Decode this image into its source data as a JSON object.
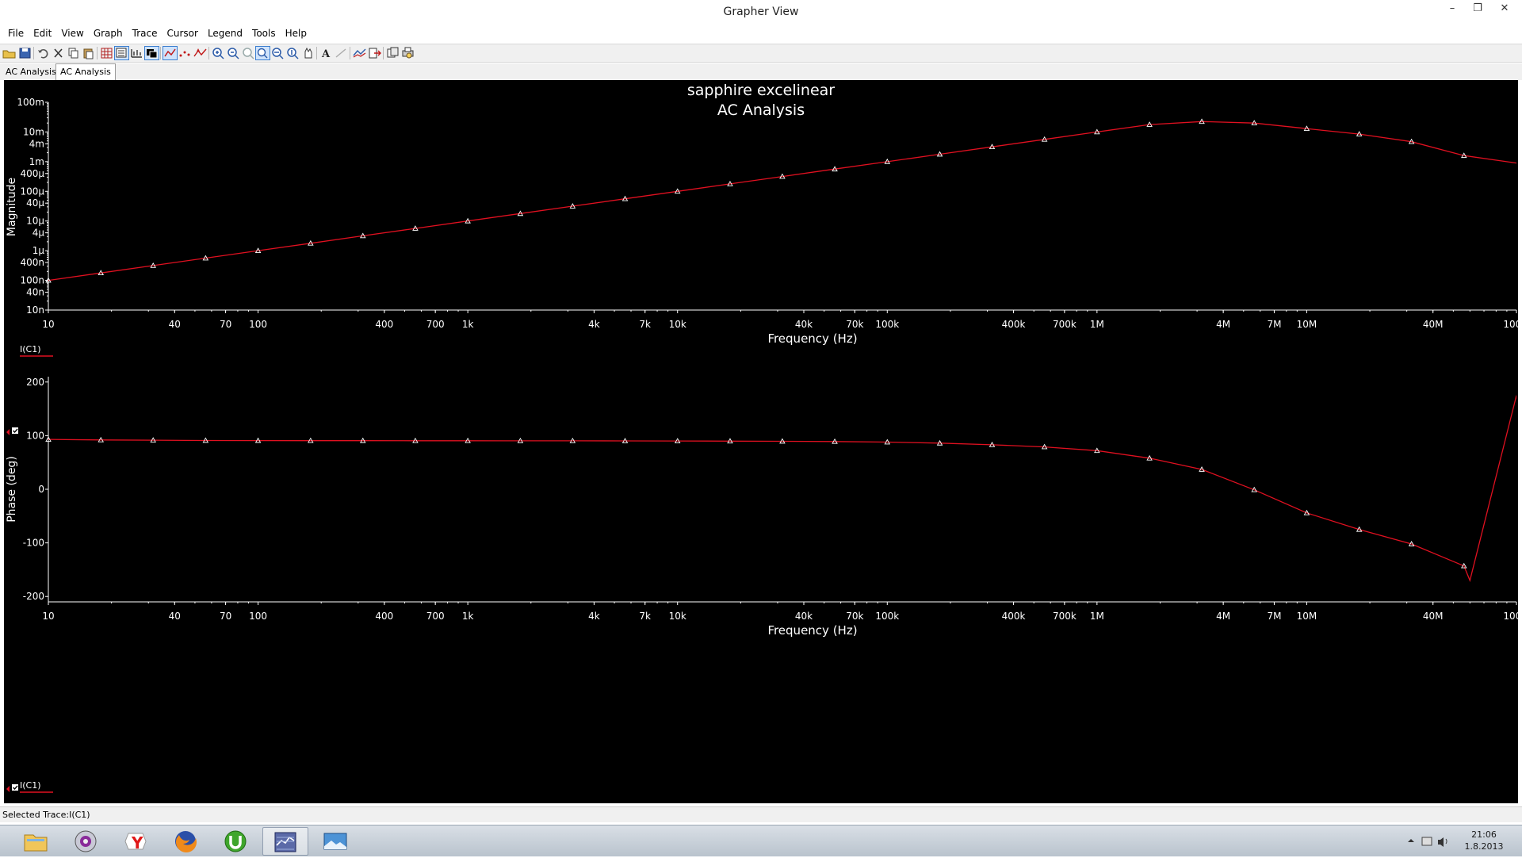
{
  "window": {
    "title": "Grapher View",
    "min": "–",
    "max": "❐",
    "close": "✕"
  },
  "menu": [
    "File",
    "Edit",
    "View",
    "Graph",
    "Trace",
    "Cursor",
    "Legend",
    "Tools",
    "Help"
  ],
  "tabs": [
    "AC Analysis",
    "AC Analysis"
  ],
  "graph": {
    "title": "sapphire excelinear",
    "subtitle": "AC Analysis",
    "legend_label": "I(C1)"
  },
  "colors": {
    "trace": "#e01020",
    "background": "#000000",
    "text": "#ffffff"
  },
  "chart_data": [
    {
      "type": "line",
      "title": "sapphire excelinear",
      "subtitle": "AC Analysis",
      "xlabel": "Frequency (Hz)",
      "ylabel": "Magnitude",
      "xscale": "log",
      "yscale": "log",
      "xlim": [
        10,
        100000000
      ],
      "ylim": [
        1e-08,
        0.1
      ],
      "grid": false,
      "x_ticks": [
        10,
        40,
        70,
        100,
        400,
        700,
        1000,
        4000,
        7000,
        10000,
        40000,
        70000,
        100000,
        400000,
        700000,
        1000000,
        4000000,
        7000000,
        10000000,
        40000000,
        100000000
      ],
      "x_tick_labels": [
        "10",
        "40",
        "70",
        "100",
        "400",
        "700",
        "1k",
        "4k",
        "7k",
        "10k",
        "40k",
        "70k",
        "100k",
        "400k",
        "700k",
        "1M",
        "4M",
        "7M",
        "10M",
        "40M",
        "100M"
      ],
      "y_ticks": [
        0.1,
        0.01,
        0.004,
        0.001,
        0.0004,
        0.0001,
        4e-05,
        1e-05,
        4e-06,
        1e-06,
        4e-07,
        1e-07,
        4e-08,
        1e-08
      ],
      "y_tick_labels": [
        "100m",
        "10m",
        "4m",
        "1m",
        "400µ",
        "100µ",
        "40µ",
        "10µ",
        "4µ",
        "1µ",
        "400n",
        "100n",
        "40n",
        "10n"
      ],
      "legend": [
        "I(C1)"
      ],
      "series": [
        {
          "name": "I(C1)",
          "x": [
            10,
            17.8,
            31.6,
            56.2,
            100,
            178,
            316,
            562,
            1000,
            1780,
            3160,
            5620,
            10000,
            17800,
            31600,
            56200,
            100000,
            178000,
            316000,
            562000,
            1000000,
            1780000,
            3160000,
            5620000,
            10000000,
            17800000,
            31600000,
            56200000,
            100000000,
            120000000
          ],
          "y": [
            1e-07,
            1.78e-07,
            3.16e-07,
            5.62e-07,
            1e-06,
            1.78e-06,
            3.16e-06,
            5.62e-06,
            1e-05,
            1.78e-05,
            3.16e-05,
            5.62e-05,
            0.0001,
            0.000178,
            0.000316,
            0.000562,
            0.001,
            0.00178,
            0.00316,
            0.00562,
            0.01,
            0.0178,
            0.0224,
            0.02,
            0.013,
            0.0085,
            0.0047,
            0.0016,
            0.0009,
            0.00085
          ]
        }
      ]
    },
    {
      "type": "line",
      "xlabel": "Frequency (Hz)",
      "ylabel": "Phase (deg)",
      "xscale": "log",
      "xlim": [
        10,
        100000000
      ],
      "ylim": [
        -210,
        210
      ],
      "grid": false,
      "x_ticks": [
        10,
        40,
        70,
        100,
        400,
        700,
        1000,
        4000,
        7000,
        10000,
        40000,
        70000,
        100000,
        400000,
        700000,
        1000000,
        4000000,
        7000000,
        10000000,
        40000000,
        100000000
      ],
      "x_tick_labels": [
        "10",
        "40",
        "70",
        "100",
        "400",
        "700",
        "1k",
        "4k",
        "7k",
        "10k",
        "40k",
        "70k",
        "100k",
        "400k",
        "700k",
        "1M",
        "4M",
        "7M",
        "10M",
        "40M",
        "100M"
      ],
      "y_ticks": [
        200,
        100,
        0,
        -100,
        -200
      ],
      "y_tick_labels": [
        "200",
        "100",
        "0",
        "-100",
        "-200"
      ],
      "legend": [
        "I(C1)"
      ],
      "series": [
        {
          "name": "I(C1)",
          "x": [
            10,
            17.8,
            31.6,
            56.2,
            100,
            178,
            316,
            562,
            1000,
            1780,
            3160,
            5620,
            10000,
            17800,
            31600,
            56200,
            100000,
            178000,
            316000,
            562000,
            1000000,
            1780000,
            3160000,
            5620000,
            10000000,
            17800000,
            31600000,
            56200000,
            60000000,
            100000000,
            120000000
          ],
          "y": [
            93,
            92,
            91.5,
            91,
            90.8,
            90.7,
            90.6,
            90.5,
            90.5,
            90.4,
            90.3,
            90.2,
            90,
            89.8,
            89.5,
            89,
            88,
            86,
            83,
            79,
            72,
            58,
            37,
            -1,
            -44,
            -75,
            -102,
            -143,
            -170,
            175,
            -66
          ],
          "markers": [
            true,
            true,
            true,
            true,
            true,
            true,
            true,
            true,
            true,
            true,
            true,
            true,
            true,
            true,
            true,
            true,
            true,
            true,
            true,
            true,
            true,
            true,
            true,
            true,
            true,
            true,
            true,
            true,
            false,
            true,
            true
          ]
        }
      ]
    }
  ],
  "status": {
    "selected_trace": "Selected Trace:I(C1)"
  },
  "taskbar": {
    "apps": [
      "file-explorer",
      "media-player",
      "yandex-browser",
      "firefox",
      "utorrent",
      "grapher",
      "photo-viewer"
    ],
    "time": "21:06",
    "date": "1.8.2013"
  }
}
